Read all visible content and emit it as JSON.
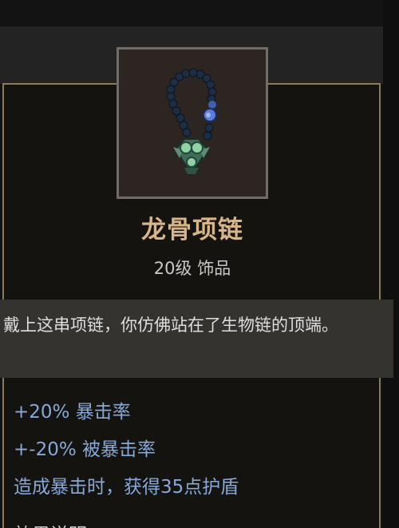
{
  "item": {
    "name": "龙骨项链",
    "meta": "20级 饰品",
    "icon": "bone-necklace-icon",
    "flavor": "戴上这串项链，你仿佛站在了生物链的顶端。",
    "stats": [
      "+20% 暴击率",
      "+-20% 被暴击率",
      "造成暴击时，获得35点护盾"
    ],
    "next_section": "效果说明"
  },
  "colors": {
    "name": "#d7b588",
    "stat": "#86a9d8",
    "border": "#8c7a5c"
  }
}
